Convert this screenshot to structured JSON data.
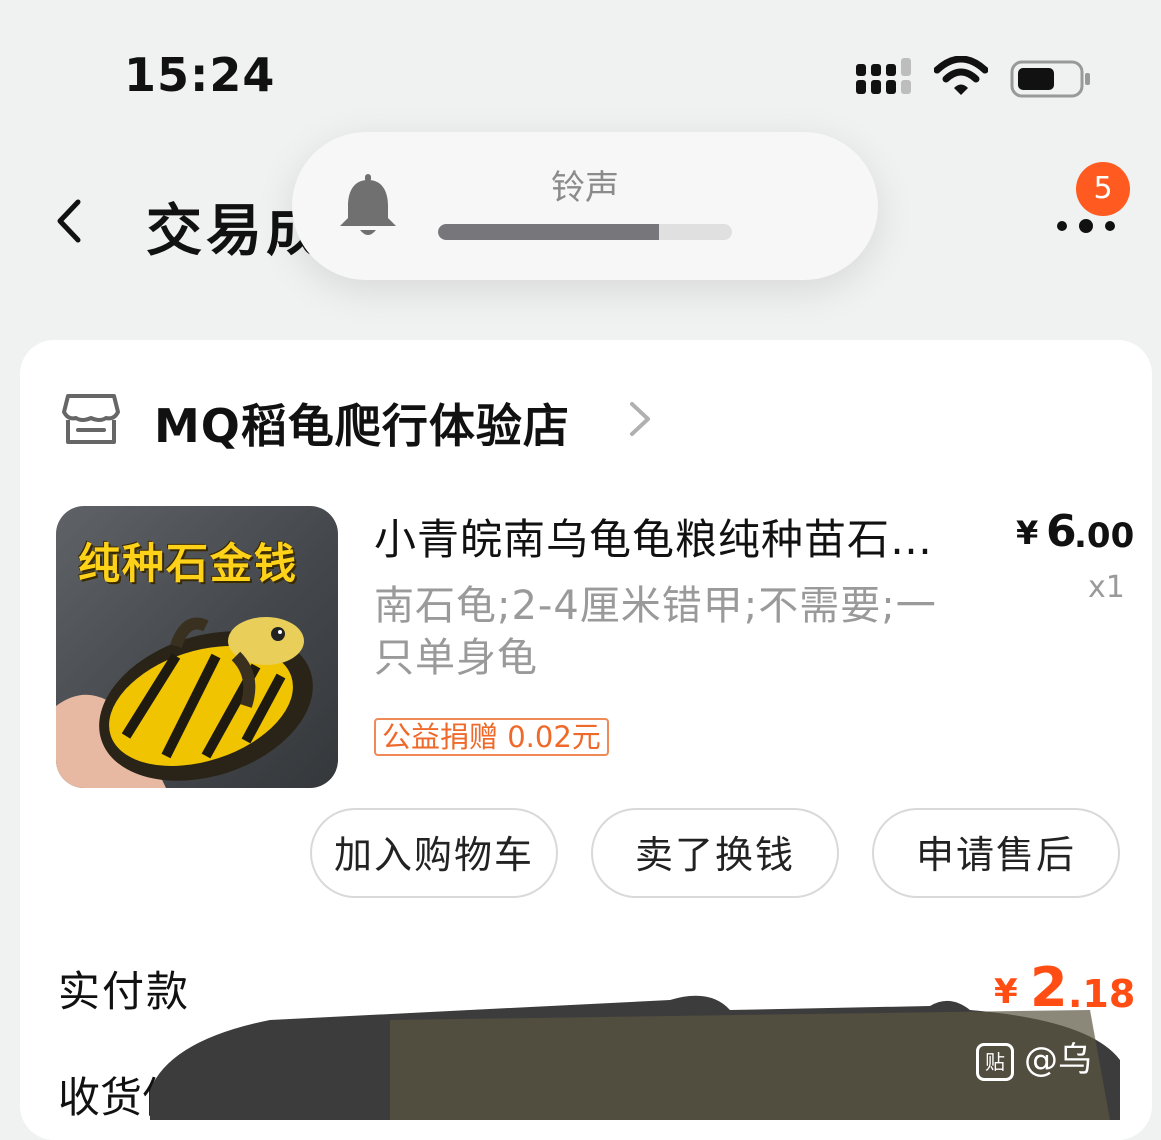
{
  "status_bar": {
    "time": "15:24",
    "signal_icon": "signal-icon",
    "wifi_icon": "wifi-icon",
    "battery_icon": "battery-icon"
  },
  "nav": {
    "title": "交易成功",
    "more_badge": "5"
  },
  "volume_hud": {
    "label": "铃声",
    "level": 0.75
  },
  "store": {
    "name": "MQ稻龟爬行体验店"
  },
  "product": {
    "image_text": "纯种石金钱",
    "title": "小青皖南乌龟龟粮纯种苗石…",
    "price_symbol": "¥",
    "price_int": "6",
    "price_dec": ".00",
    "quantity": "x1",
    "specs": "南石龟;2-4厘米错甲;不需要;一只单身龟",
    "charity": "公益捐赠 0.02元"
  },
  "actions": {
    "add_to_cart": "加入购物车",
    "resell": "卖了换钱",
    "after_sale": "申请售后"
  },
  "payment": {
    "label": "实付款",
    "symbol": "¥",
    "amount_int": "2",
    "amount_dec": ".18"
  },
  "shipping": {
    "label": "收货信息"
  },
  "watermark": {
    "icon_text": "贴",
    "text": "@乌"
  },
  "colors": {
    "accent": "#ff4d14",
    "badge": "#ff5a1f",
    "background": "#f0f1f1"
  }
}
